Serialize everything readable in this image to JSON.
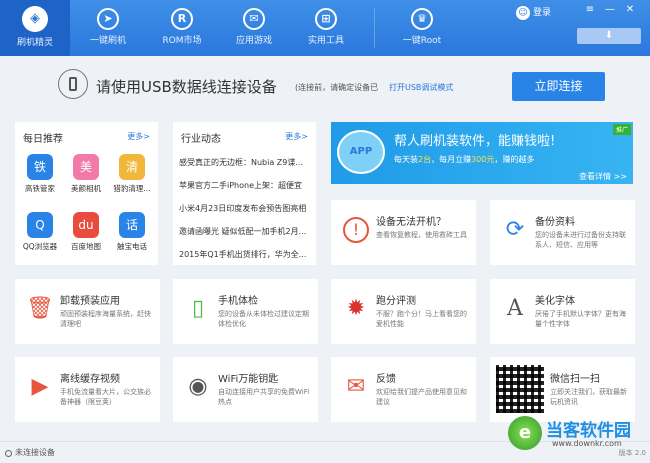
{
  "nav": [
    {
      "label": "刷机精灵",
      "icon": "logo-icon"
    },
    {
      "label": "一键刷机",
      "icon": "cursor-icon"
    },
    {
      "label": "ROM市场",
      "icon": "rom-icon"
    },
    {
      "label": "应用游戏",
      "icon": "mail-icon"
    },
    {
      "label": "实用工具",
      "icon": "grid-icon"
    },
    {
      "label": "一键Root",
      "icon": "root-icon"
    }
  ],
  "login": "登录",
  "connect": {
    "title": "请使用USB数据线连接设备",
    "hint": "(连接前，请确定设备已",
    "link": "打开USB调试模式",
    "button": "立即连接"
  },
  "daily": {
    "title": "每日推荐",
    "more": "更多>",
    "apps": [
      {
        "label": "高铁管家",
        "color": "#2a84e8",
        "glyph": "铁"
      },
      {
        "label": "美颜相机",
        "color": "#f27aa8",
        "glyph": "美"
      },
      {
        "label": "猎豹清理...",
        "color": "#f2b63a",
        "glyph": "清"
      },
      {
        "label": "QQ浏览器",
        "color": "#2a84e8",
        "glyph": "Q"
      },
      {
        "label": "百度地图",
        "color": "#e84c3d",
        "glyph": "du"
      },
      {
        "label": "触宝电话",
        "color": "#2a84e8",
        "glyph": "话"
      }
    ]
  },
  "news": {
    "title": "行业动态",
    "more": "更多>",
    "items": [
      "感受真正的无边框：Nubia Z9谍...",
      "苹果官方二手iPhone上架：超便宜",
      "小米4月23日印度发布会预告图亮相",
      "邀请函曝光 疑似低配一加手机2月...",
      "2015年Q1手机出货排行，华为全..."
    ]
  },
  "banner": {
    "title": "帮人刷机装软件，能赚钱啦!",
    "sub_prefix": "每天装",
    "sub_n1": "2台",
    "sub_mid": "，每月立赚",
    "sub_n2": "300元",
    "sub_suffix": "，赚的越多",
    "details": "查看详情 >>",
    "tag": "推广",
    "mascot": "APP"
  },
  "tiles": [
    {
      "title": "设备无法开机？",
      "desc": "查看恢复教程，使用救砖工具",
      "icon": "!",
      "color": "#e8553d"
    },
    {
      "title": "备份资料",
      "desc": "您的设备未进行过备份支持联系人、短信、应用等",
      "icon": "⟳",
      "color": "#2a84e8"
    },
    {
      "title": "卸载预装应用",
      "desc": "顽固预装程序海量系统，赶快清理吧",
      "icon": "🗑",
      "color": "#e8553d"
    },
    {
      "title": "手机体检",
      "desc": "您的设备从未体检过建议定期体检优化",
      "icon": "▯",
      "color": "#4cb84c"
    },
    {
      "title": "跑分评测",
      "desc": "不服？跑个分！马上看看您的爱机性能",
      "icon": "A",
      "color": "#d9342b"
    },
    {
      "title": "美化字体",
      "desc": "厌倦了手机默认字体？更有海量个性字体",
      "icon": "A",
      "color": "#555"
    },
    {
      "title": "离线缓存视频",
      "desc": "手机免流量看大片，公交族必备神器（限豆荚）",
      "icon": "▶",
      "color": "#e8553d"
    },
    {
      "title": "WiFi万能钥匙",
      "desc": "自动连接用户共享的免费WiFi热点",
      "icon": "◉",
      "color": "#555"
    },
    {
      "title": "反馈",
      "desc": "欢迎给我们提产品使用意见和建议",
      "icon": "✉",
      "color": "#e8553d"
    },
    {
      "title": "微信扫一扫",
      "desc": "立即关注我们，获取最新玩机资讯",
      "icon": "",
      "color": "#333"
    }
  ],
  "status": {
    "text": "未连接设备",
    "version": "版本 2.0"
  },
  "watermark": {
    "title": "当客软件园",
    "url": "www.downkr.com"
  }
}
